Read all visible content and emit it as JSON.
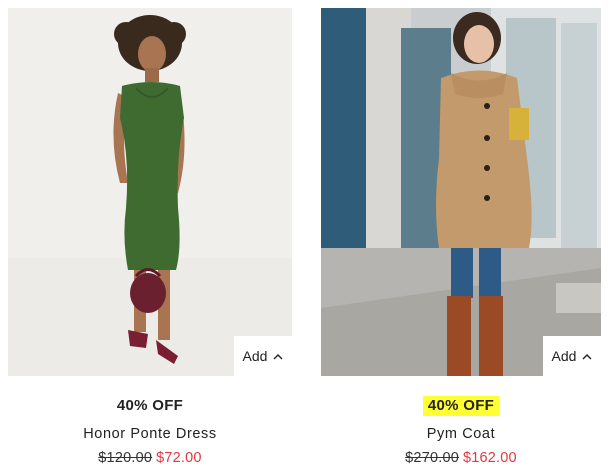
{
  "products": [
    {
      "id": "honor-ponte-dress",
      "image_alt": "Woman in a green fitted dress with burgundy heels and bag",
      "add_label": "Add",
      "discount": "40% OFF",
      "name": "Honor Ponte Dress",
      "original_price": "$120.00",
      "sale_price": "$72.00"
    },
    {
      "id": "pym-coat",
      "image_alt": "Woman in a camel coat with rust knee-high boots",
      "add_label": "Add",
      "discount": "40% OFF",
      "name": "Pym Coat",
      "original_price": "$270.00",
      "sale_price": "$162.00"
    }
  ],
  "colors": {
    "sale_price": "#e0383f",
    "discount_highlight": "#ffff33"
  },
  "icons": {
    "add": "chevron-up-icon"
  }
}
